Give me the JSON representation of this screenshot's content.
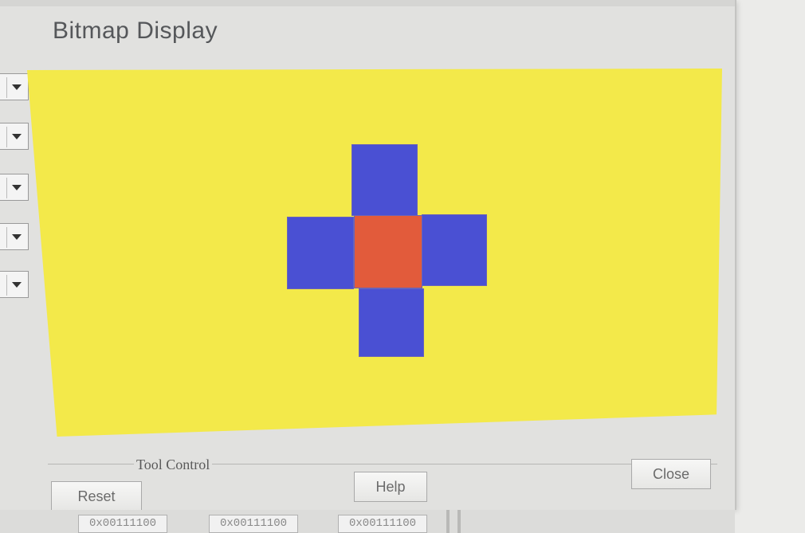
{
  "window": {
    "title": "Bitmap Display"
  },
  "bitmap": {
    "background_color": "#f3e94a",
    "cells": [
      {
        "color": "#4a50d3"
      },
      {
        "color": "#4a50d3"
      },
      {
        "color": "#e25b3b"
      },
      {
        "color": "#4a50d3"
      },
      {
        "color": "#4a50d3"
      }
    ]
  },
  "tool_control": {
    "label": "Tool Control",
    "reset_label": "Reset",
    "help_label": "Help",
    "close_label": "Close"
  },
  "left_dropdowns": [
    {
      "icon": "chevron-down-icon"
    },
    {
      "icon": "chevron-down-icon"
    },
    {
      "icon": "chevron-down-icon"
    },
    {
      "icon": "chevron-down-icon"
    },
    {
      "icon": "chevron-down-icon"
    }
  ],
  "bottom_cells": [
    "0x00111100",
    "0x00111100",
    "0x00111100"
  ]
}
